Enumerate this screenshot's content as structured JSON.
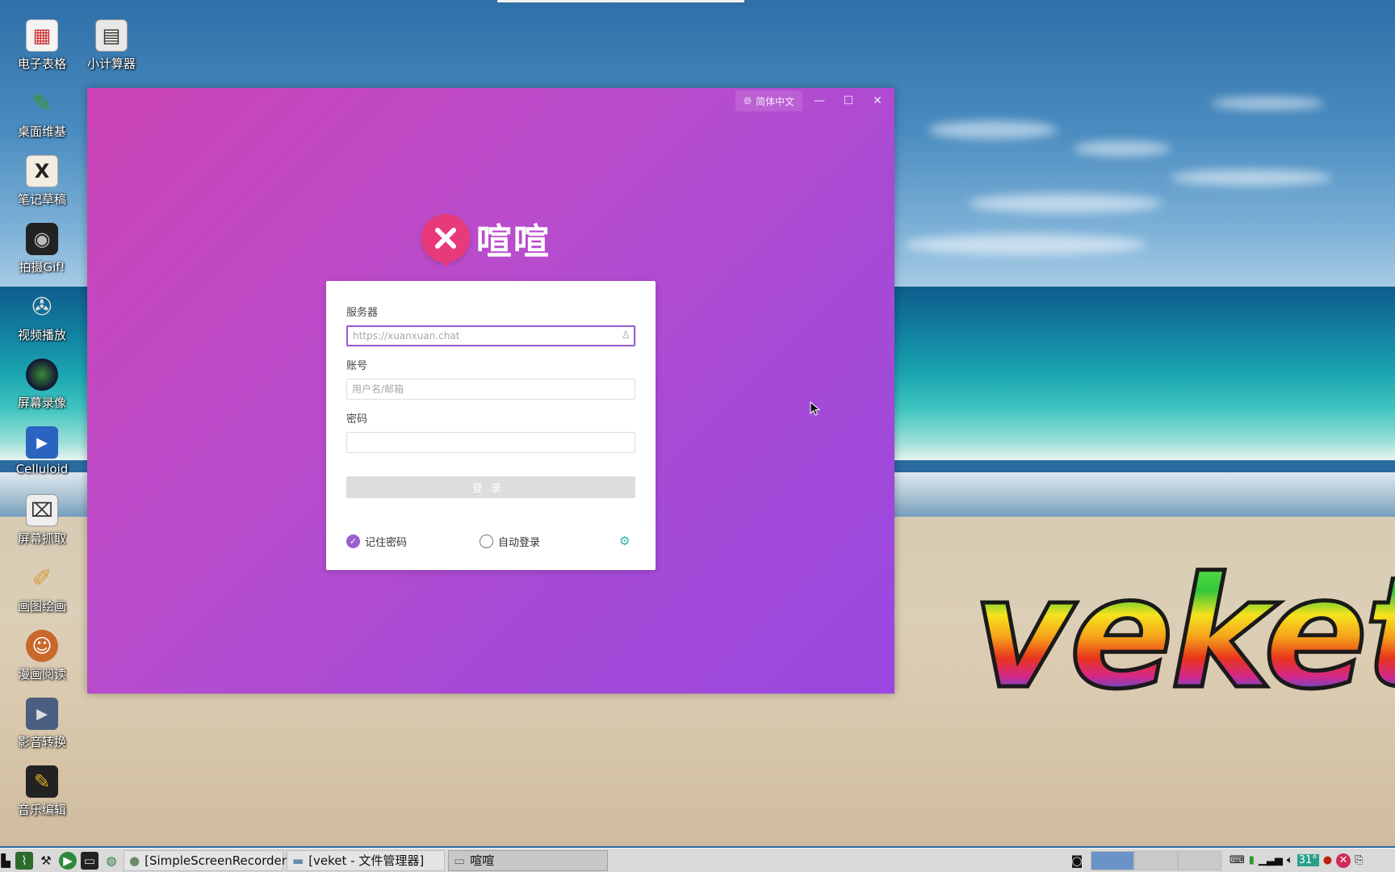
{
  "desktop": {
    "icons": [
      {
        "label": "电子表格",
        "icon": "spreadsheet-icon"
      },
      {
        "label": "小计算器",
        "icon": "calculator-icon"
      },
      {
        "label": "桌面维基",
        "icon": "wiki-icon"
      },
      {
        "label": "笔记草稿",
        "icon": "notes-icon"
      },
      {
        "label": "拍摄Gif!",
        "icon": "camera-icon"
      },
      {
        "label": "视频播放",
        "icon": "video-player-icon"
      },
      {
        "label": "屏幕录像",
        "icon": "screen-record-icon"
      },
      {
        "label": "Celluloid",
        "icon": "celluloid-icon"
      },
      {
        "label": "屏幕抓取",
        "icon": "screenshot-icon"
      },
      {
        "label": "画图绘画",
        "icon": "paint-icon"
      },
      {
        "label": "漫画阅读",
        "icon": "comic-reader-icon"
      },
      {
        "label": "影音转换",
        "icon": "media-convert-icon"
      },
      {
        "label": "音乐编辑",
        "icon": "music-edit-icon"
      }
    ],
    "wallpaper_text": "veket"
  },
  "window": {
    "language_label": "简体中文",
    "brand_name": "喧喧",
    "colors": {
      "gradient_start": "#cc44b6",
      "gradient_end": "#9a48e0",
      "accent": "#9a5fd0",
      "logo": "#e83a7a"
    }
  },
  "login": {
    "server_label": "服务器",
    "server_placeholder": "https://xuanxuan.chat",
    "account_label": "账号",
    "account_placeholder": "用户名/邮箱",
    "password_label": "密码",
    "password_value": "",
    "submit_label": "登录",
    "remember_password_label": "记住密码",
    "remember_password_checked": true,
    "auto_login_label": "自动登录",
    "auto_login_checked": false
  },
  "taskbar": {
    "tasks": [
      {
        "label": "[SimpleScreenRecorder]",
        "active": false
      },
      {
        "label": "[veket - 文件管理器]",
        "active": false
      },
      {
        "label": "喧喧",
        "active": true
      }
    ],
    "tray_temp": "31°"
  }
}
